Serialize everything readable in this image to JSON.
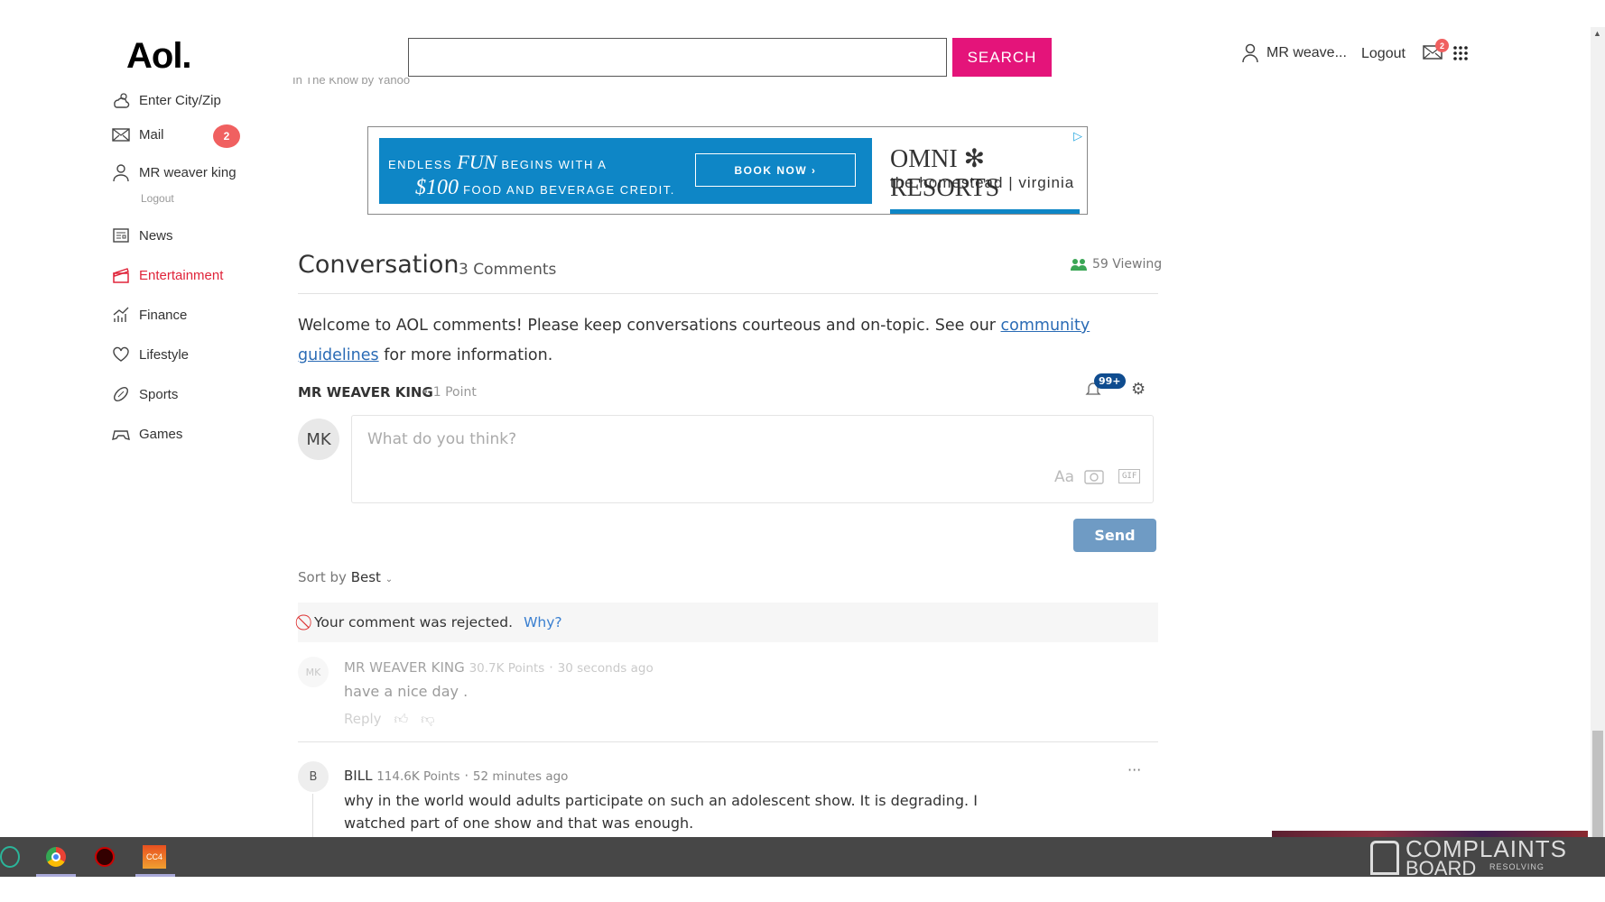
{
  "header": {
    "logo": "Aol.",
    "search_value": "",
    "search_button": "SEARCH",
    "username": "MR weave...",
    "logout": "Logout",
    "mail_badge": "2"
  },
  "sidebar": {
    "items": [
      {
        "label": "Enter City/Zip",
        "icon": "weather-icon"
      },
      {
        "label": "Mail",
        "icon": "mail-icon",
        "badge": "2"
      },
      {
        "label": "MR weaver king",
        "icon": "user-icon",
        "sub": "Logout"
      },
      {
        "label": "News",
        "icon": "news-icon"
      },
      {
        "label": "Entertainment",
        "icon": "clapper-icon",
        "active": true
      },
      {
        "label": "Finance",
        "icon": "chart-icon"
      },
      {
        "label": "Lifestyle",
        "icon": "heart-icon"
      },
      {
        "label": "Sports",
        "icon": "football-icon"
      },
      {
        "label": "Games",
        "icon": "gamepad-icon"
      }
    ]
  },
  "source_caption": "In The Know by Yahoo",
  "ad": {
    "line1a": "ENDLESS ",
    "line1b": "FUN",
    "line1c": " BEGINS WITH A",
    "line2a": "$100",
    "line2b": " FOOD AND BEVERAGE CREDIT.",
    "cta": "BOOK NOW ›",
    "brand": "OMNI ✻ RESORTS",
    "brand_sub": "the homestead | virginia"
  },
  "conversation": {
    "title": "Conversation",
    "count": "3 Comments",
    "viewing": "59 Viewing",
    "welcome_pre": "Welcome to AOL comments! Please keep conversations courteous and on-topic. See our ",
    "welcome_link": "community guidelines",
    "welcome_post": " for more information.",
    "user": "MR WEAVER KING",
    "user_points": "1 Point",
    "notif_badge": "99+",
    "avatar": "MK",
    "placeholder": "What do you think?",
    "format_label": "Aa",
    "gif_label": "GIF",
    "send": "Send",
    "sort_label": "Sort by",
    "sort_value": "Best",
    "rejected": "Your comment was rejected.",
    "why": "Why?",
    "comments": [
      {
        "avatar": "MK",
        "name": "MR WEAVER KING",
        "points": "30.7K Points",
        "time": "30 seconds ago",
        "text": "have a nice day .",
        "reply": "Reply"
      },
      {
        "avatar": "B",
        "name": "BILL",
        "points": "114.6K Points",
        "time": "52 minutes ago",
        "text": "why in the world would adults participate on such an adolescent show. It is degrading. I watched part of one show and that was enough.",
        "more": "···"
      }
    ]
  },
  "watermark": {
    "line1": "COMPLAINTS",
    "line2": "BOARD",
    "tag": "RESOLVING"
  },
  "colors": {
    "accent": "#e4147a",
    "active": "#e0243a",
    "send": "#6f9bc4",
    "ad": "#0e86c6"
  }
}
